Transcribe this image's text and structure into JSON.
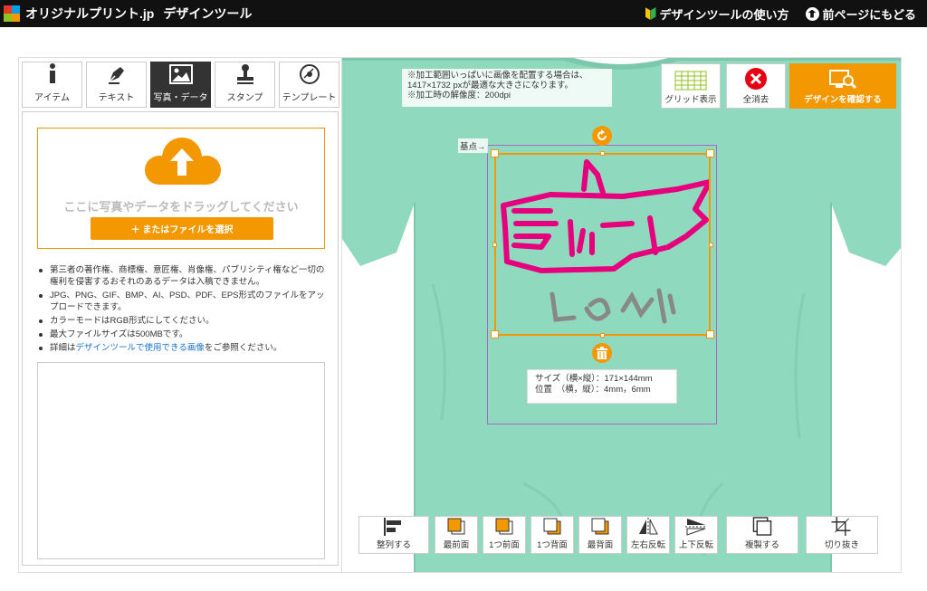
{
  "header": {
    "brand": "オリジナルプリント.jp",
    "subtitle": "デザインツール",
    "howto_link": "デザインツールの使い方",
    "back_link": "前ページにもどる",
    "bg_color": "#111111"
  },
  "tabs": [
    {
      "label": "アイテム",
      "icon": "item-info-icon",
      "active": false
    },
    {
      "label": "テキスト",
      "icon": "pen-icon",
      "active": false
    },
    {
      "label": "写真・データ",
      "icon": "image-icon",
      "active": true
    },
    {
      "label": "スタンプ",
      "icon": "stamp-icon",
      "active": false
    },
    {
      "label": "テンプレート",
      "icon": "template-icon",
      "active": false
    }
  ],
  "upload": {
    "drop_text": "ここに写真やデータをドラッグしてください",
    "file_button": "＋ またはファイルを選択",
    "notes": [
      "第三者の著作権、商標権、意匠権、肖像権、パブリシティ権など一切の権利を侵害するおそれのあるデータは入稿できません。",
      "JPG、PNG、GIF、BMP、AI、PSD、PDF、EPS形式のファイルをアップロードできます。",
      "カラーモードはRGB形式にしてください。",
      "最大ファイルサイズは500MBです。"
    ],
    "detail_prefix": "詳細は",
    "detail_link": "デザインツールで使用できる画像",
    "detail_suffix": "をご参照ください。"
  },
  "canvas": {
    "info_line1": "※加工範囲いっぱいに画像を配置する場合は、",
    "info_line2": "1417×1732 pxが最適な大きさになります。",
    "info_line3": "※加工時の解像度：200dpi",
    "basepoint_label": "基点→",
    "size_line1": "サイズ（横×縦）：171×144mm",
    "size_line2": "位置　（横，縦）：4mm，6mm",
    "shirt_color": "#8fd9bf",
    "accent_color": "#f39800"
  },
  "top_tools": {
    "grid": "グリッド表示",
    "clear": "全消去",
    "confirm": "デザインを確認する"
  },
  "bottom_tools": [
    {
      "label": "整列する",
      "icon": "align-icon"
    },
    {
      "label": "最前面",
      "icon": "bring-front-icon"
    },
    {
      "label": "1つ前面",
      "icon": "forward-icon"
    },
    {
      "label": "1つ背面",
      "icon": "backward-icon"
    },
    {
      "label": "最背面",
      "icon": "send-back-icon"
    },
    {
      "label": "左右反転",
      "icon": "flip-horizontal-icon"
    },
    {
      "label": "上下反転",
      "icon": "flip-vertical-icon"
    },
    {
      "label": "複製する",
      "icon": "duplicate-icon"
    },
    {
      "label": "切り抜き",
      "icon": "crop-icon"
    }
  ]
}
